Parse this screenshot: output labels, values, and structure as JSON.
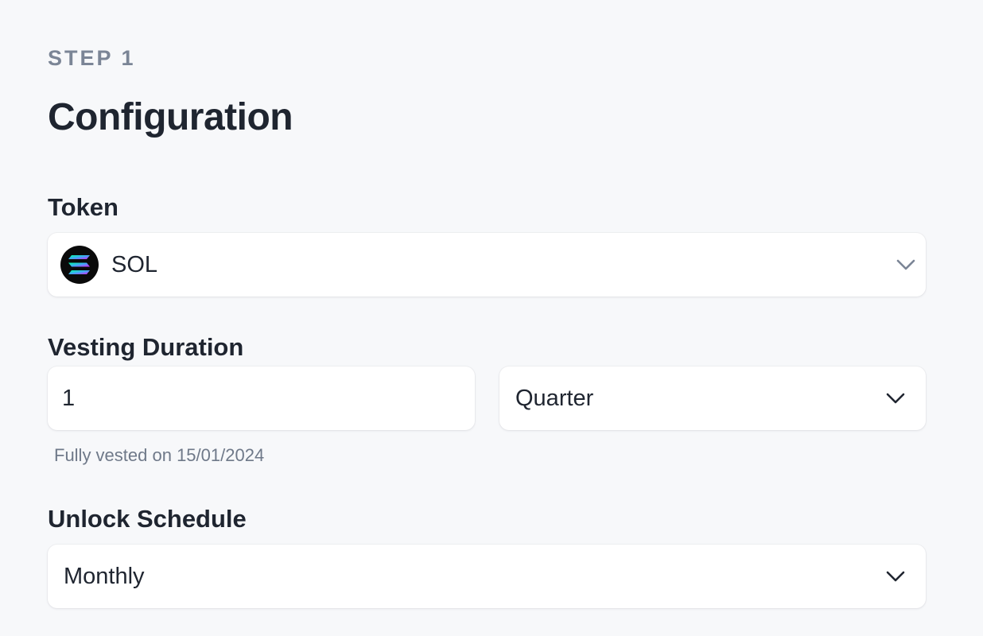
{
  "header": {
    "step": "STEP 1",
    "title": "Configuration"
  },
  "token": {
    "label": "Token",
    "selected": "SOL",
    "icon": "solana-logo-icon"
  },
  "vesting": {
    "label": "Vesting Duration",
    "duration_value": "1",
    "period_selected": "Quarter",
    "helper": "Fully vested on 15/01/2024"
  },
  "unlock": {
    "label": "Unlock Schedule",
    "selected": "Monthly"
  },
  "colors": {
    "background": "#f7f8fa",
    "text_primary": "#1f2530",
    "text_muted": "#7b8596",
    "chevron": "#7b8596"
  }
}
